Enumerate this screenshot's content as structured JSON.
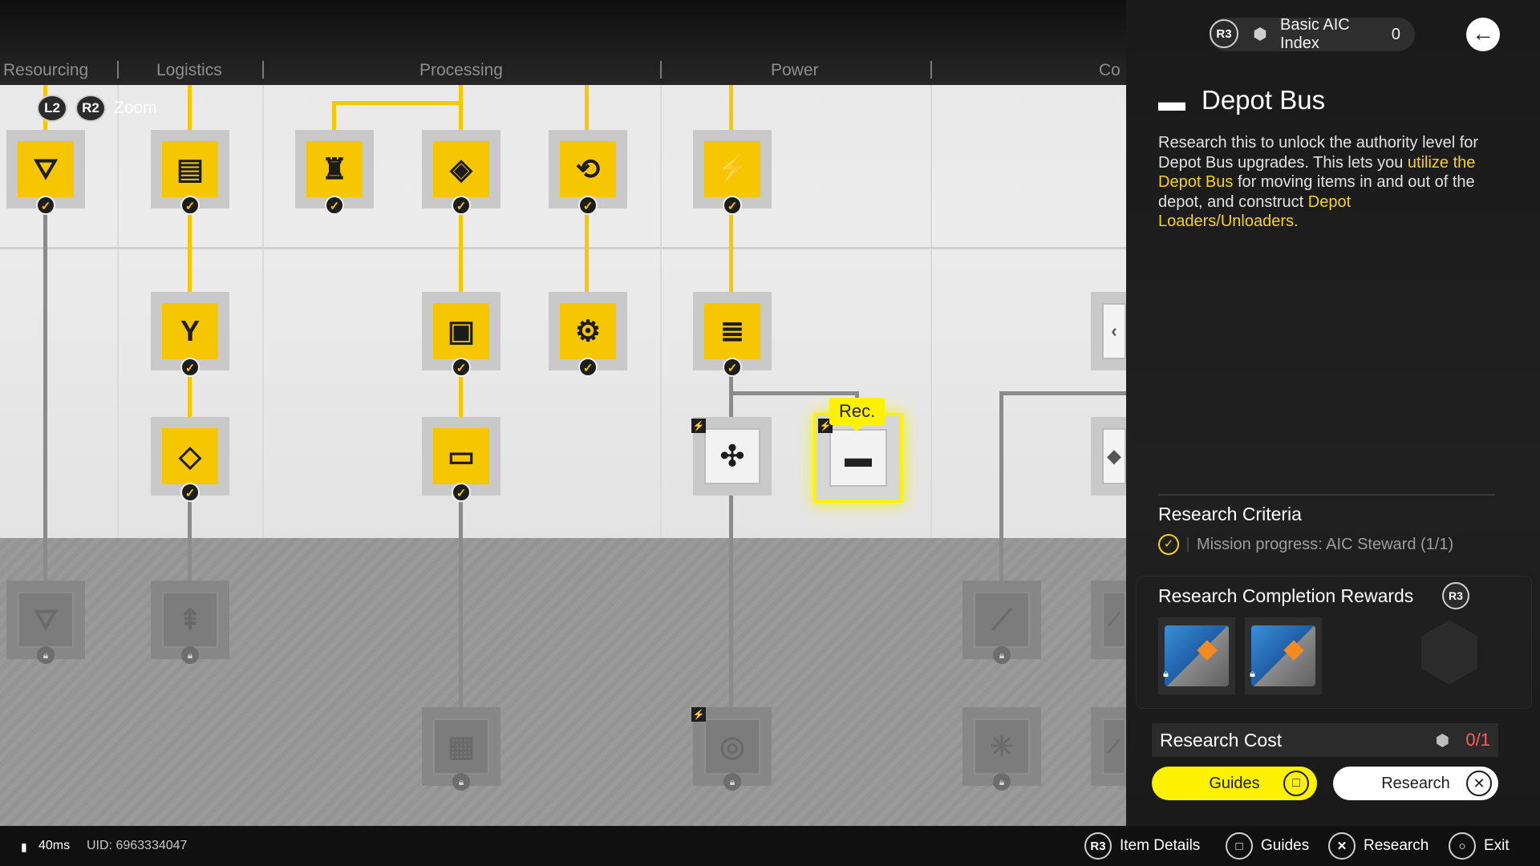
{
  "categories": [
    "Resourcing",
    "Logistics",
    "Processing",
    "Power",
    "Co"
  ],
  "zoom": {
    "l2": "L2",
    "r2": "R2",
    "label": "Zoom"
  },
  "selected_tag": "Rec.",
  "index": {
    "r3": "R3",
    "label": "Basic AIC Index",
    "value": "0"
  },
  "detail": {
    "title": "Depot Bus",
    "desc_a": "Research this to unlock the authority level for Depot Bus upgrades. This lets you ",
    "desc_hl1": "utilize the Depot Bus",
    "desc_b": " for moving items in and out of the depot, and construct ",
    "desc_hl2": "Depot Loaders/Unloaders."
  },
  "criteria": {
    "title": "Research Criteria",
    "text": "Mission progress: AIC Steward (1/1)"
  },
  "rewards": {
    "title": "Research Completion Rewards",
    "r3": "R3"
  },
  "cost": {
    "label": "Research Cost",
    "value": "0/1"
  },
  "buttons": {
    "guides": "Guides",
    "research": "Research"
  },
  "status": {
    "ping": "40ms",
    "uid": "UID: 6963334047"
  },
  "hints": [
    {
      "key": "R3",
      "label": "Item Details"
    },
    {
      "key": "□",
      "label": "Guides"
    },
    {
      "key": "✕",
      "label": "Research"
    },
    {
      "key": "○",
      "label": "Exit"
    }
  ],
  "icons": {
    "node_check": "checkmark-icon",
    "node_lock": "lock-icon",
    "back": "back-arrow-icon",
    "cube": "aic-cube-icon"
  },
  "colors": {
    "accent": "#f6c700",
    "highlight": "#fff200",
    "cost_red": "#ff5c5c",
    "desc_highlight": "#f6d21c"
  }
}
